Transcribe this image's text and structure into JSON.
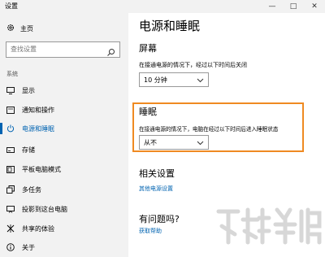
{
  "window": {
    "title": "设置"
  },
  "sidebar": {
    "home_label": "主页",
    "search_placeholder": "查找设置",
    "section_label": "系统",
    "items": [
      {
        "label": "显示",
        "icon": "display-icon"
      },
      {
        "label": "通知和操作",
        "icon": "notification-icon"
      },
      {
        "label": "电源和睡眠",
        "icon": "power-icon",
        "active": true
      },
      {
        "label": "存储",
        "icon": "storage-icon"
      },
      {
        "label": "平板电脑模式",
        "icon": "tablet-icon"
      },
      {
        "label": "多任务",
        "icon": "multitask-icon"
      },
      {
        "label": "投影到这台电脑",
        "icon": "project-icon"
      },
      {
        "label": "共享的体验",
        "icon": "shared-icon"
      },
      {
        "label": "关于",
        "icon": "info-icon"
      }
    ]
  },
  "main": {
    "title": "电源和睡眠",
    "screen": {
      "heading": "屏幕",
      "desc": "在接通电源的情况下，经过以下时间后关闭",
      "value": "10 分钟"
    },
    "sleep": {
      "heading": "睡眠",
      "desc": "在接通电源的情况下，电脑在经过以下时间后进入睡眠状态",
      "value": "从不"
    },
    "related": {
      "heading": "相关设置",
      "link": "其他电源设置"
    },
    "help": {
      "heading": "有问题吗?",
      "link": "获取帮助"
    }
  },
  "colors": {
    "accent": "#0063b1",
    "highlight": "#ef8a22"
  }
}
